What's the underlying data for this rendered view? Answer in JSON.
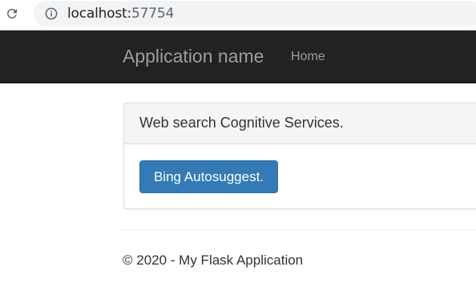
{
  "browser": {
    "url_host": "localhost:",
    "url_port": "57754"
  },
  "navbar": {
    "brand": "Application name",
    "home_label": "Home"
  },
  "panel": {
    "heading": "Web search Cognitive Services.",
    "button_label": "Bing Autosuggest."
  },
  "footer": {
    "text": "© 2020 - My Flask Application"
  },
  "colors": {
    "navbar_bg": "#222222",
    "nav_text": "#9d9d9d",
    "button_bg": "#337ab7",
    "panel_heading_bg": "#f5f5f5"
  }
}
